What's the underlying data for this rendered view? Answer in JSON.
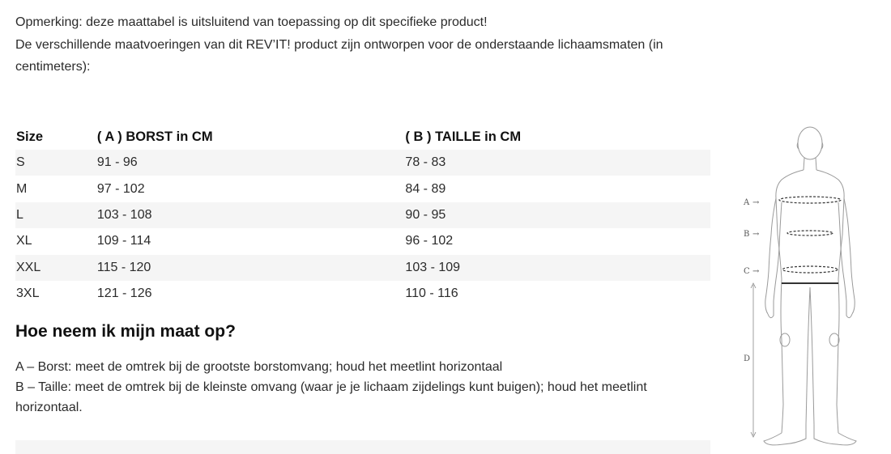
{
  "intro": {
    "line1": "Opmerking: deze maattabel is uitsluitend van toepassing op dit specifieke product!",
    "line2": "De verschillende maatvoeringen van dit REV’IT! product zijn ontworpen voor de onderstaande lichaamsmaten (in centimeters):"
  },
  "size_table": {
    "headers": [
      "Size",
      "( A ) BORST in CM",
      "( B ) TAILLE in CM"
    ],
    "rows": [
      [
        "S",
        "91 - 96",
        "78 - 83"
      ],
      [
        "M",
        "97 - 102",
        "84 - 89"
      ],
      [
        "L",
        "103 - 108",
        "90 - 95"
      ],
      [
        "XL",
        "109 - 114",
        "96 - 102"
      ],
      [
        "XXL",
        "115 - 120",
        "103 - 109"
      ],
      [
        "3XL",
        "121 - 126",
        "110 - 116"
      ]
    ]
  },
  "howto": {
    "title": "Hoe neem ik mijn maat op?",
    "a": "A – Borst: meet de omtrek bij de grootste borstomvang; houd het meetlint horizontaal",
    "b": "B – Taille: meet de omtrek bij de kleinste omvang (waar je je lichaam zijdelings kunt buigen); houd het meetlint horizontaal."
  },
  "figure": {
    "label_a": "A",
    "label_b": "B",
    "label_c": "C",
    "label_d": "D",
    "arrow": "→"
  },
  "colors": {
    "row_shade": "#f5f5f5",
    "text": "#2b2b2b",
    "figure_line": "#9a9a9a",
    "measure_line": "#333333"
  }
}
